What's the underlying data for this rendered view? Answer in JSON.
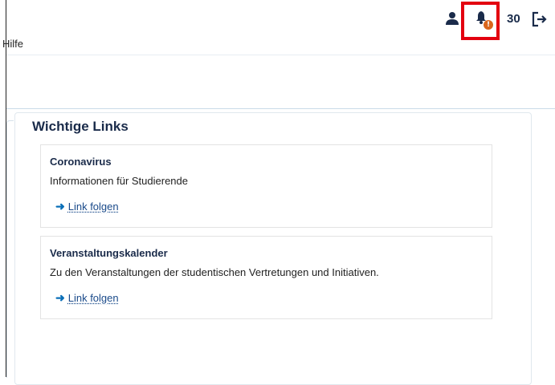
{
  "header": {
    "user_icon": "user-icon",
    "bell_icon": "bell-icon",
    "badge": "!",
    "count": "30",
    "logout_icon": "logout-icon"
  },
  "nav": {
    "help": "Hilfe"
  },
  "section": {
    "title": "Wichtige Links",
    "cards": [
      {
        "title": "Coronavirus",
        "text": "Informationen für Studierende",
        "link": "Link folgen"
      },
      {
        "title": "Veranstaltungskalender",
        "text": "Zu den Veranstaltungen der studentischen Vertretungen und Initiativen.",
        "link": "Link folgen"
      }
    ]
  },
  "colors": {
    "highlight": "#e3000f",
    "badge": "#d9661c",
    "title": "#1a2b4a",
    "link_arrow": "#0a6fb8"
  }
}
